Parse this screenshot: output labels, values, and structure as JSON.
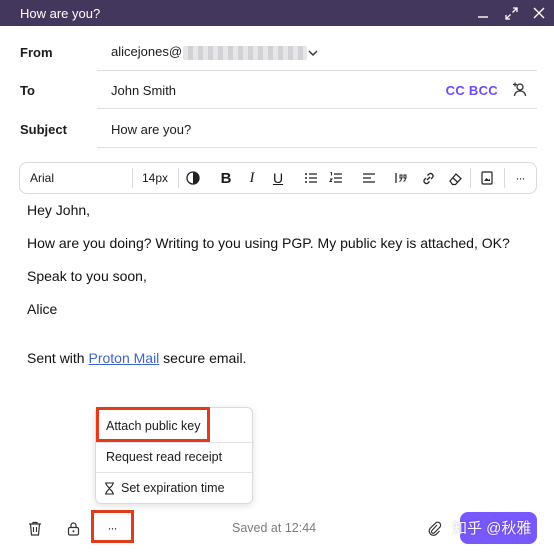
{
  "window": {
    "title": "How are you?"
  },
  "fields": {
    "from_label": "From",
    "from_value": "alicejones@",
    "to_label": "To",
    "to_value": "John Smith",
    "cc_bcc": "CC BCC",
    "subject_label": "Subject",
    "subject_value": "How are you?"
  },
  "toolbar": {
    "font": "Arial",
    "size": "14px",
    "bold": "B",
    "italic": "I",
    "underline": "U",
    "more": "···"
  },
  "body": {
    "greeting": "Hey John,",
    "line1": "How are you doing? Writing to you using PGP. My public key is attached, OK?",
    "line2": "Speak to you soon,",
    "signoff": "Alice",
    "sent_prefix": "Sent with ",
    "sent_link": "Proton Mail",
    "sent_suffix": " secure email."
  },
  "menu": {
    "items": [
      "Attach public key",
      "Request read receipt",
      "Set expiration time"
    ]
  },
  "footer": {
    "saved": "Saved at 12:44",
    "more": "···",
    "watermark": "知乎 @秋雅"
  },
  "colors": {
    "titlebar": "#44375e",
    "accent": "#6d4aff",
    "highlight": "#e33a1c",
    "link": "#3f64c8"
  }
}
